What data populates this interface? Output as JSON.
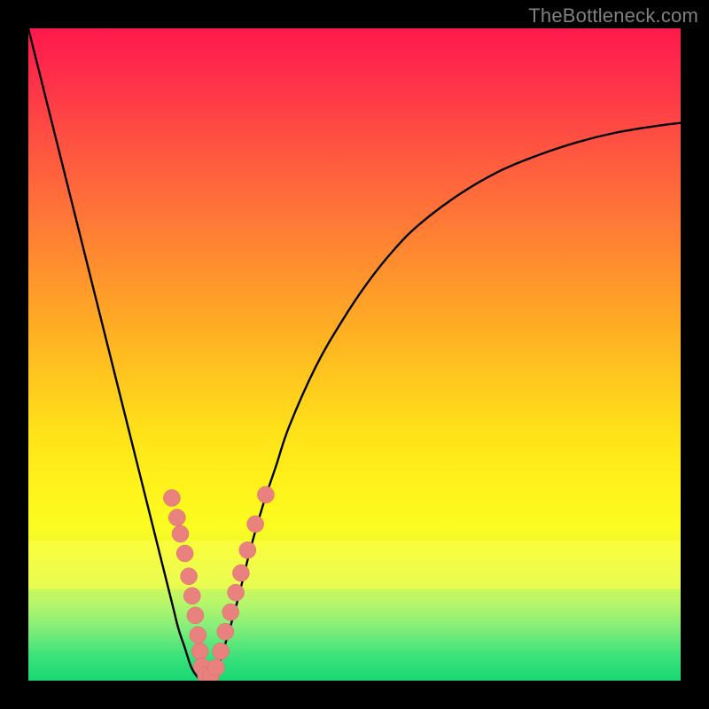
{
  "attribution": "TheBottleneck.com",
  "colors": {
    "frame": "#000000",
    "curve": "#000000",
    "marker_fill": "#e9817e",
    "marker_stroke": "#d96e6b",
    "gradient_top": "#ff1a4d",
    "gradient_bottom": "#18d874",
    "highlight_band": "#feff4a"
  },
  "chart_data": {
    "type": "line",
    "title": "",
    "xlabel": "",
    "ylabel": "",
    "xlim": [
      0,
      100
    ],
    "ylim": [
      0,
      100
    ],
    "grid": false,
    "legend": false,
    "series": [
      {
        "name": "bottleneck-curve",
        "x": [
          0,
          2,
          4,
          6,
          8,
          10,
          12,
          14,
          16,
          18,
          20,
          22,
          23,
          24,
          25,
          26,
          27,
          28,
          29,
          30,
          32,
          34,
          36,
          38,
          40,
          44,
          48,
          52,
          56,
          60,
          66,
          72,
          78,
          84,
          90,
          96,
          100
        ],
        "values": [
          100,
          92,
          84,
          76,
          68,
          60,
          52,
          44,
          36,
          28,
          20,
          12,
          8,
          5,
          2,
          0.5,
          0,
          0.5,
          2,
          5,
          12,
          20,
          27,
          33,
          39,
          48,
          55,
          61,
          66,
          70,
          74.5,
          78,
          80.5,
          82.5,
          84,
          85,
          85.5
        ]
      }
    ],
    "markers": [
      {
        "name": "left-branch-marker",
        "x": 22.0,
        "y": 28.0
      },
      {
        "name": "left-branch-marker",
        "x": 22.8,
        "y": 25.0
      },
      {
        "name": "left-branch-marker",
        "x": 23.3,
        "y": 22.5
      },
      {
        "name": "left-branch-marker",
        "x": 24.0,
        "y": 19.5
      },
      {
        "name": "left-branch-marker",
        "x": 24.6,
        "y": 16.0
      },
      {
        "name": "left-branch-marker",
        "x": 25.1,
        "y": 13.0
      },
      {
        "name": "left-branch-marker",
        "x": 25.6,
        "y": 10.0
      },
      {
        "name": "left-branch-marker",
        "x": 26.0,
        "y": 7.0
      },
      {
        "name": "left-branch-marker",
        "x": 26.3,
        "y": 4.5
      },
      {
        "name": "vertex-marker",
        "x": 26.6,
        "y": 2.2
      },
      {
        "name": "vertex-marker",
        "x": 27.2,
        "y": 0.8
      },
      {
        "name": "vertex-marker",
        "x": 28.0,
        "y": 0.8
      },
      {
        "name": "vertex-marker",
        "x": 28.8,
        "y": 2.0
      },
      {
        "name": "right-branch-marker",
        "x": 29.5,
        "y": 4.5
      },
      {
        "name": "right-branch-marker",
        "x": 30.2,
        "y": 7.5
      },
      {
        "name": "right-branch-marker",
        "x": 31.0,
        "y": 10.5
      },
      {
        "name": "right-branch-marker",
        "x": 31.8,
        "y": 13.5
      },
      {
        "name": "right-branch-marker",
        "x": 32.6,
        "y": 16.5
      },
      {
        "name": "right-branch-marker",
        "x": 33.6,
        "y": 20.0
      },
      {
        "name": "right-branch-marker",
        "x": 34.8,
        "y": 24.0
      },
      {
        "name": "right-branch-marker",
        "x": 36.4,
        "y": 28.5
      }
    ]
  }
}
